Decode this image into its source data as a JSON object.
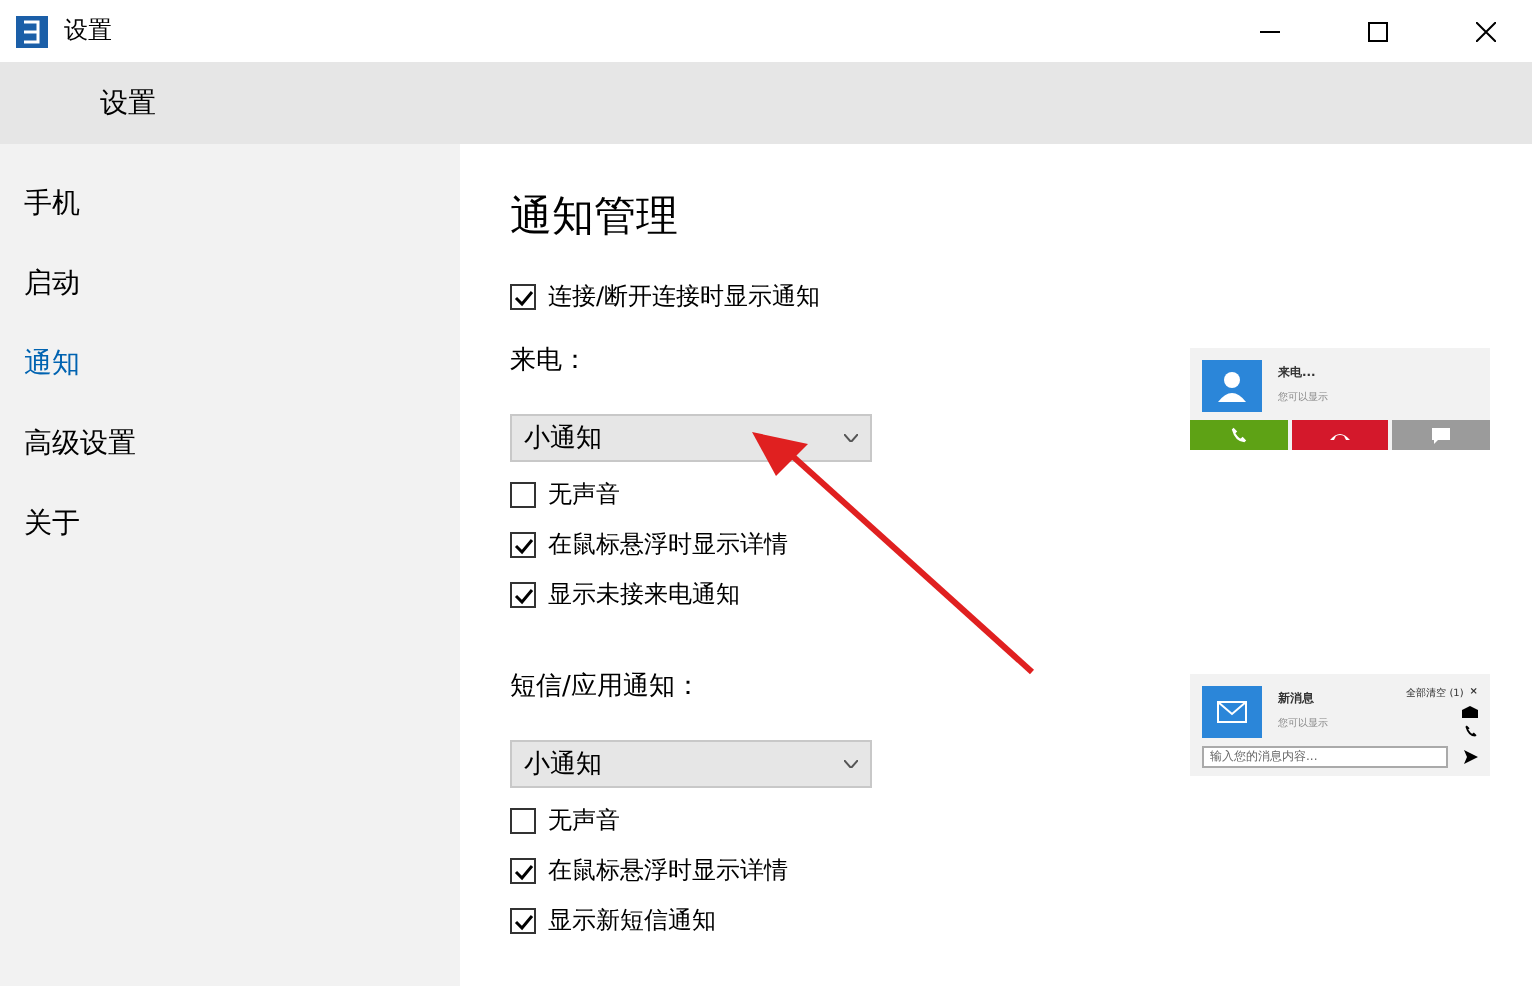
{
  "window": {
    "title": "设置"
  },
  "header": {
    "title": "设置"
  },
  "sidebar": {
    "items": [
      {
        "label": "手机",
        "selected": false
      },
      {
        "label": "启动",
        "selected": false
      },
      {
        "label": "通知",
        "selected": true
      },
      {
        "label": "高级设置",
        "selected": false
      },
      {
        "label": "关于",
        "selected": false
      }
    ]
  },
  "page": {
    "title": "通知管理",
    "top_option": {
      "label": "连接/断开连接时显示通知",
      "checked": true
    }
  },
  "sections": [
    {
      "label": "来电：",
      "dropdown": "小通知",
      "options": [
        {
          "label": "无声音",
          "checked": false
        },
        {
          "label": "在鼠标悬浮时显示详情",
          "checked": true
        },
        {
          "label": "显示未接来电通知",
          "checked": true
        }
      ],
      "preview": {
        "kind": "call",
        "title": "来电...",
        "subtitle": "您可以显示"
      }
    },
    {
      "label": "短信/应用通知：",
      "dropdown": "小通知",
      "options": [
        {
          "label": "无声音",
          "checked": false
        },
        {
          "label": "在鼠标悬浮时显示详情",
          "checked": true
        },
        {
          "label": "显示新短信通知",
          "checked": true
        }
      ],
      "preview": {
        "kind": "message",
        "title": "新消息",
        "subtitle": "您可以显示",
        "clear": "全部清空 (1)",
        "close": "×",
        "placeholder": "输入您的消息内容..."
      }
    }
  ]
}
